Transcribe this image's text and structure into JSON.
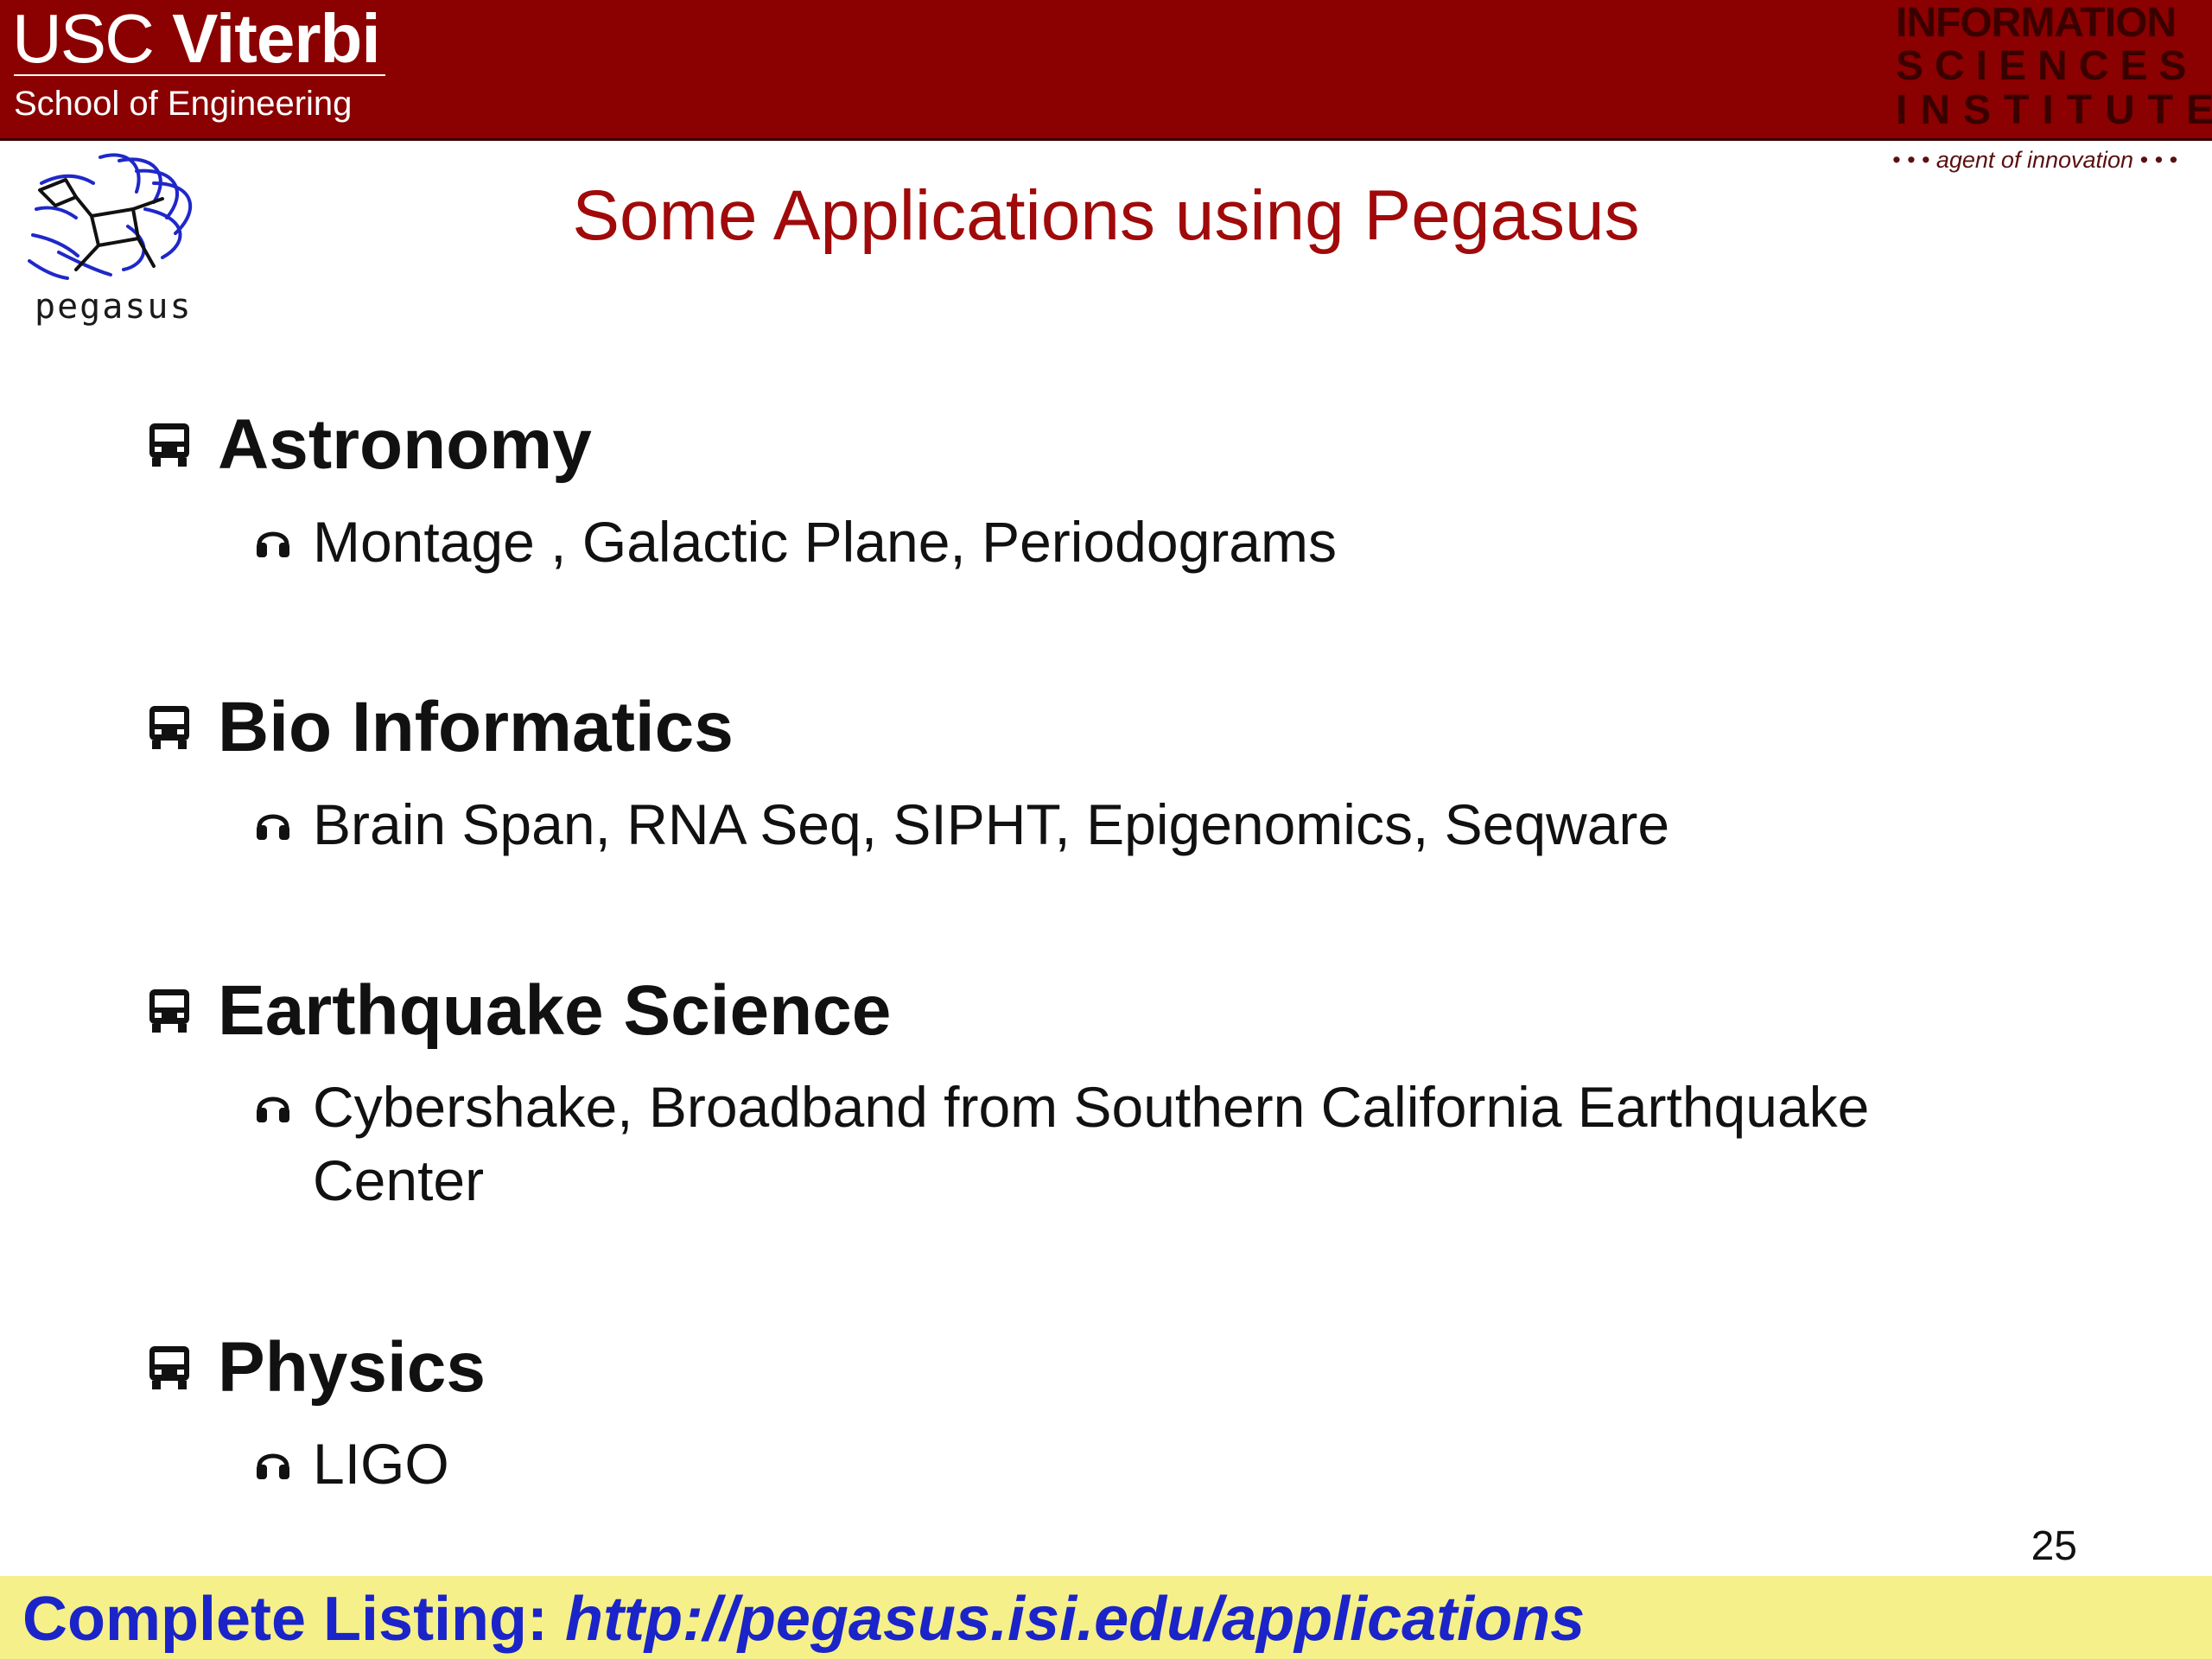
{
  "header": {
    "usc": "USC",
    "viterbi": "Viterbi",
    "school": "School of Engineering",
    "isi_line1": "INFORMATION",
    "isi_line2": "SCIENCES",
    "isi_line3": "INSTITUTE",
    "isi_tagline": "• • • agent of innovation • • •"
  },
  "pegasus_logo_text": "pegasus",
  "slide": {
    "title": "Some Applications using Pegasus",
    "sections": [
      {
        "heading": "Astronomy",
        "items": [
          "Montage , Galactic Plane, Periodograms"
        ]
      },
      {
        "heading": "Bio Informatics",
        "items": [
          "Brain Span, RNA Seq, SIPHT, Epigenomics, Seqware"
        ]
      },
      {
        "heading": "Earthquake Science",
        "items": [
          "Cybershake, Broadband from Southern California Earthquake",
          "Center"
        ]
      },
      {
        "heading": "Physics",
        "items": [
          "LIGO"
        ]
      }
    ],
    "page_number": "25"
  },
  "footer": {
    "label": "Complete Listing:",
    "url": "http://pegasus.isi.edu/applications"
  },
  "colors": {
    "header_bg": "#8b0000",
    "title": "#a00a0a",
    "footer_bg": "#f5f08a",
    "footer_text": "#1a24c8"
  }
}
